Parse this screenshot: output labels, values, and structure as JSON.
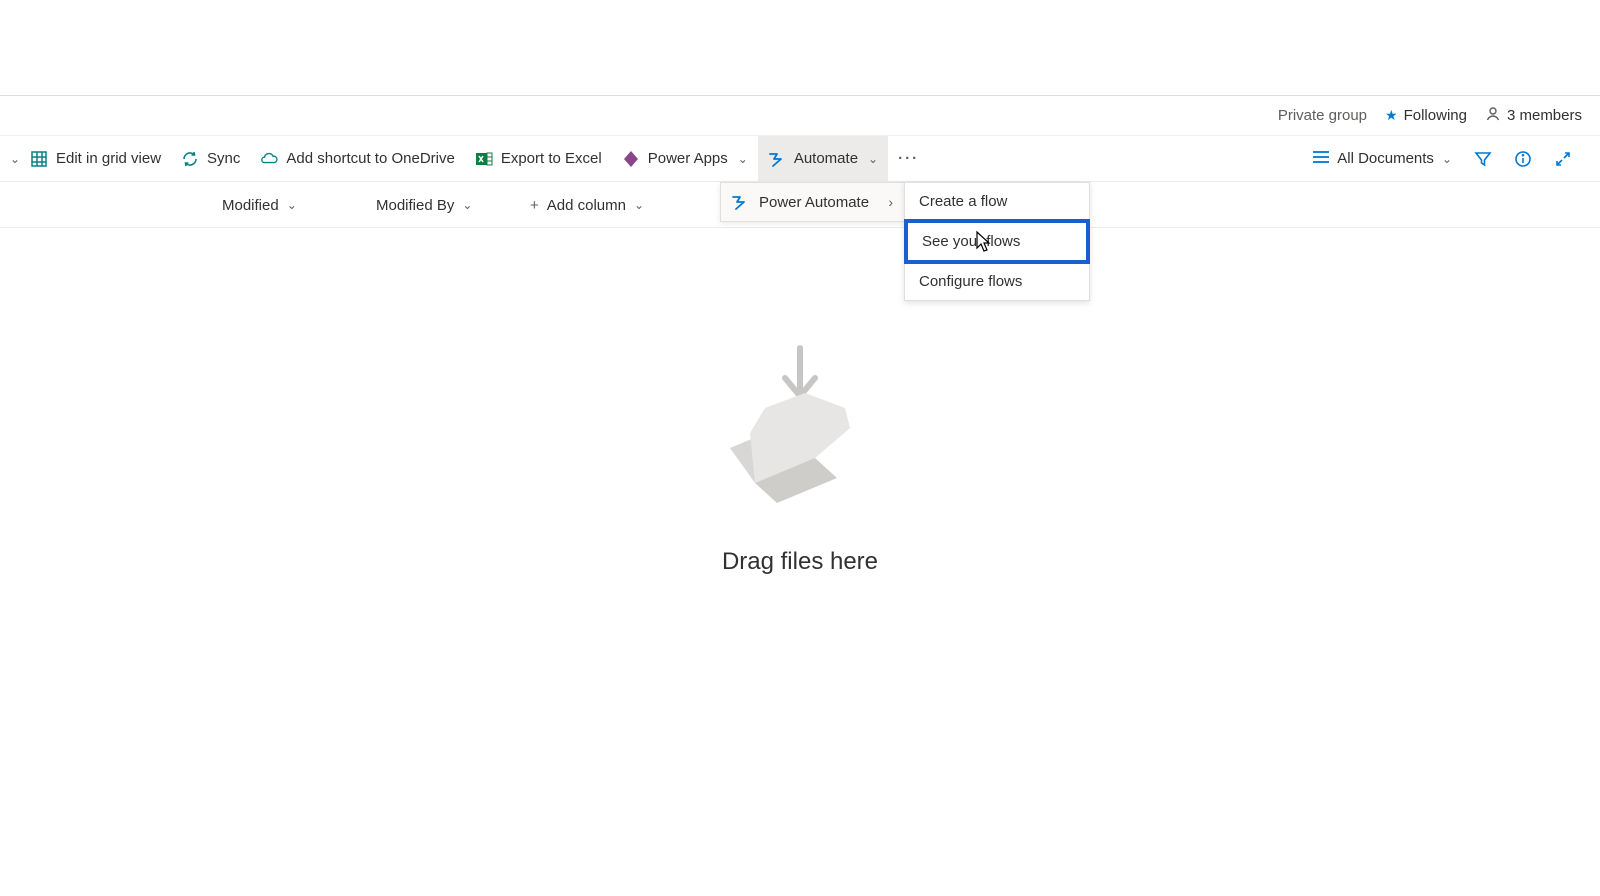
{
  "header": {
    "group_type": "Private group",
    "following_label": "Following",
    "members_label": "3 members"
  },
  "commands": {
    "truncated_first_chev": "",
    "edit_grid": "Edit in grid view",
    "sync": "Sync",
    "shortcut": "Add shortcut to OneDrive",
    "export_excel": "Export to Excel",
    "power_apps": "Power Apps",
    "automate": "Automate",
    "more": "···"
  },
  "view": {
    "selector_label": "All Documents"
  },
  "automate_menu": {
    "power_automate": "Power Automate",
    "items": {
      "create": "Create a flow",
      "see": "See your flows",
      "configure": "Configure flows"
    }
  },
  "columns": {
    "modified": "Modified",
    "modified_by": "Modified By",
    "add_column": "Add column"
  },
  "empty_state": {
    "label": "Drag files here"
  }
}
